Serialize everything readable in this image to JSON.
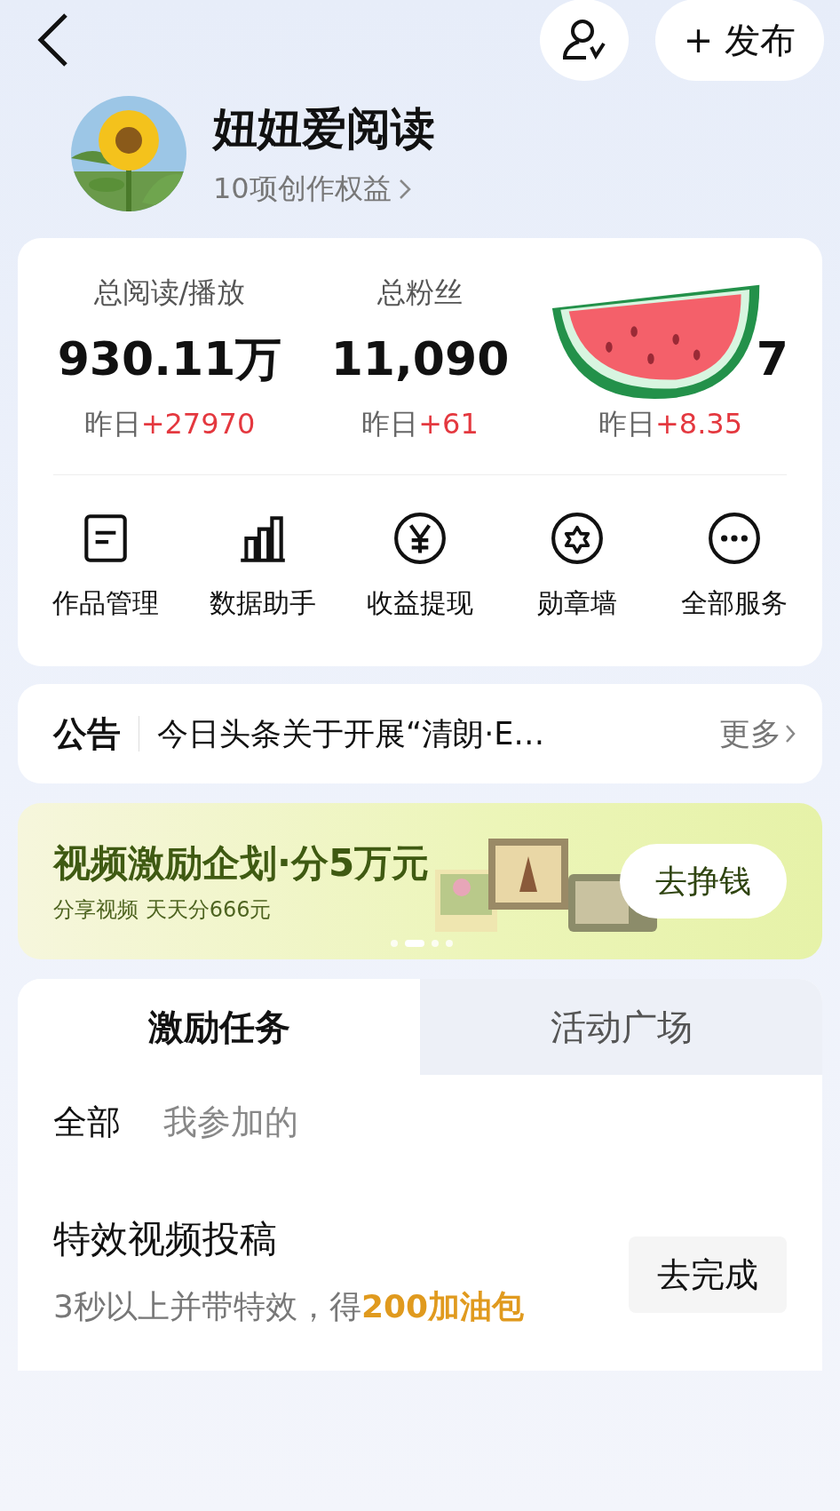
{
  "header": {
    "publish_button": "+ 发布"
  },
  "profile": {
    "name": "妞妞爱阅读",
    "benefits": "10项创作权益"
  },
  "stats": [
    {
      "label": "总阅读/播放",
      "value": "930.11万",
      "yesterday_label": "昨日",
      "yesterday_delta": "+27970"
    },
    {
      "label": "总粉丝",
      "value": "11,090",
      "yesterday_label": "昨日",
      "yesterday_delta": "+61"
    },
    {
      "value": "7",
      "yesterday_label": "昨日",
      "yesterday_delta": "+8.35"
    }
  ],
  "services": [
    {
      "label": "作品管理",
      "kind": "doc"
    },
    {
      "label": "数据助手",
      "kind": "bars"
    },
    {
      "label": "收益提现",
      "kind": "yen"
    },
    {
      "label": "勋章墙",
      "kind": "medal"
    },
    {
      "label": "全部服务",
      "kind": "more"
    }
  ],
  "notice": {
    "label": "公告",
    "text": "今日头条关于开展“清朗·E…",
    "more": "更多"
  },
  "banner": {
    "title": "视频激励企划·分5万元",
    "subtitle": "分享视频 天天分666元",
    "button": "去挣钱",
    "dots": [
      {
        "selected": false
      },
      {
        "selected": true
      },
      {
        "selected": false
      },
      {
        "selected": false
      }
    ]
  },
  "tabs": [
    {
      "label": "激励任务",
      "selected": true
    },
    {
      "label": "活动广场",
      "selected": false
    }
  ],
  "filters": [
    {
      "label": "全部",
      "selected": true
    },
    {
      "label": "我参加的",
      "selected": false
    }
  ],
  "tasks": [
    {
      "title": "特效视频投稿",
      "description": "3秒以上并带特效，得**200加油包**",
      "button": "去完成"
    }
  ]
}
